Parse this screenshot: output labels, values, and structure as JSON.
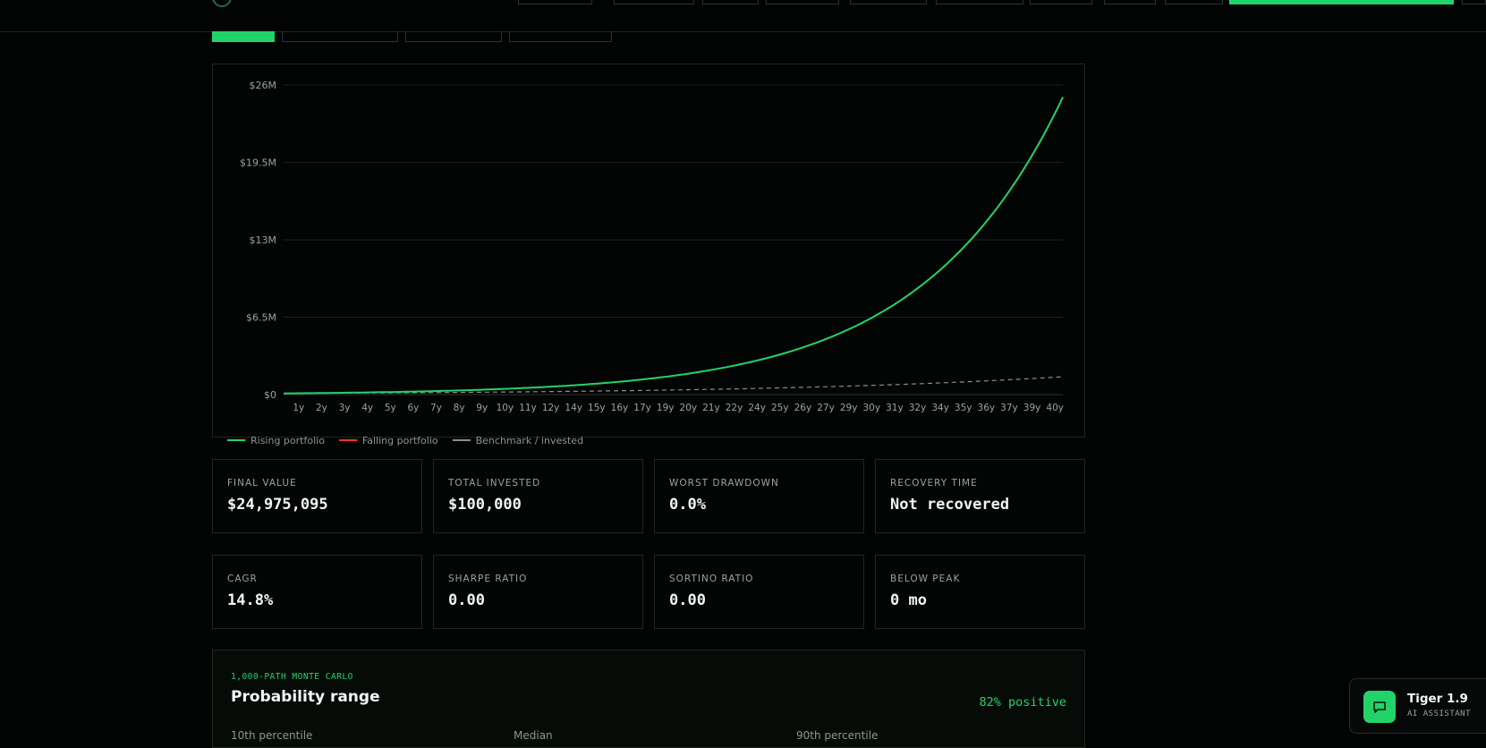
{
  "header": {
    "brand_icon": "tiger-logo-icon"
  },
  "chart_data": {
    "type": "line",
    "title": "",
    "xlabel": "",
    "ylabel": "",
    "y_ticks": [
      "$0",
      "$6.5M",
      "$13M",
      "$19.5M",
      "$26M"
    ],
    "y_tick_values": [
      0,
      6500000,
      13000000,
      19500000,
      26000000
    ],
    "ylim": [
      0,
      26000000
    ],
    "x_tick_labels": [
      "1y",
      "2y",
      "3y",
      "4y",
      "5y",
      "6y",
      "7y",
      "8y",
      "9y",
      "10y",
      "11y",
      "12y",
      "14y",
      "15y",
      "16y",
      "17y",
      "19y",
      "20y",
      "21y",
      "22y",
      "24y",
      "25y",
      "26y",
      "27y",
      "29y",
      "30y",
      "31y",
      "32y",
      "34y",
      "35y",
      "36y",
      "37y",
      "39y",
      "40y"
    ],
    "x_range_years": [
      0,
      40
    ],
    "grid": true,
    "legend_position": "bottom-left",
    "series": [
      {
        "name": "Rising portfolio",
        "color": "#22d36a",
        "style": "solid",
        "start_value": 100000,
        "end_value": 24975095
      },
      {
        "name": "Falling portfolio",
        "color": "#e53935",
        "style": "solid"
      },
      {
        "name": "Benchmark / invested",
        "color": "#8a8f8c",
        "style": "dashed",
        "start_value": 100000,
        "end_value": 1500000
      }
    ]
  },
  "stats_row1": [
    {
      "label": "FINAL VALUE",
      "value": "$24,975,095"
    },
    {
      "label": "TOTAL INVESTED",
      "value": "$100,000"
    },
    {
      "label": "WORST DRAWDOWN",
      "value": "0.0%"
    },
    {
      "label": "RECOVERY TIME",
      "value": "Not recovered"
    }
  ],
  "stats_row2": [
    {
      "label": "CAGR",
      "value": "14.8%"
    },
    {
      "label": "SHARPE RATIO",
      "value": "0.00"
    },
    {
      "label": "SORTINO RATIO",
      "value": "0.00"
    },
    {
      "label": "BELOW PEAK",
      "value": "0 mo"
    }
  ],
  "monte_carlo": {
    "kicker": "1,000-PATH MONTE CARLO",
    "title": "Probability range",
    "positive": "82% positive",
    "columns": [
      "10th percentile",
      "Median",
      "90th percentile"
    ]
  },
  "assistant": {
    "name": "Tiger 1.9",
    "subtitle": "AI ASSISTANT",
    "icon": "chat-bubble-icon"
  }
}
